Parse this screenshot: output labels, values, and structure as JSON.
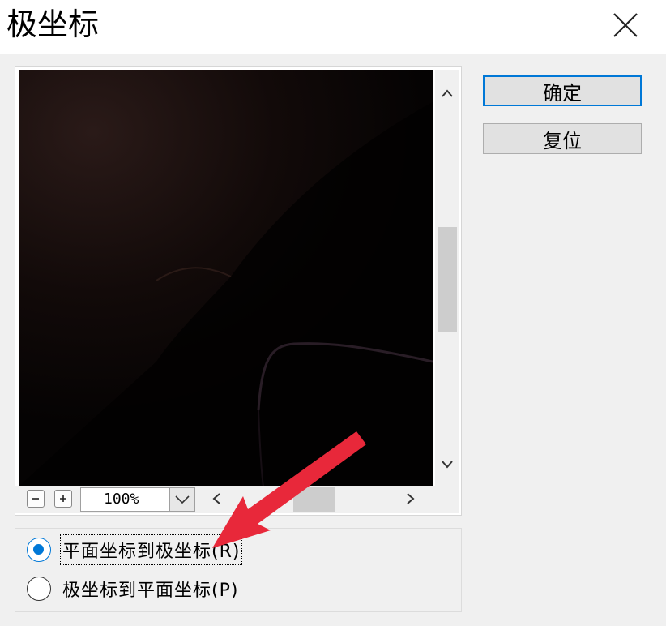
{
  "dialog": {
    "title": "极坐标"
  },
  "buttons": {
    "ok_label": "确定",
    "reset_label": "复位"
  },
  "preview": {
    "zoom_value": "100%"
  },
  "options": {
    "selected": 0,
    "items": [
      {
        "label": "平面坐标到极坐标(R)",
        "checked": true
      },
      {
        "label": "极坐标到平面坐标(P)",
        "checked": false
      }
    ]
  },
  "colors": {
    "accent": "#0078d7",
    "annotation": "#e8283a"
  }
}
